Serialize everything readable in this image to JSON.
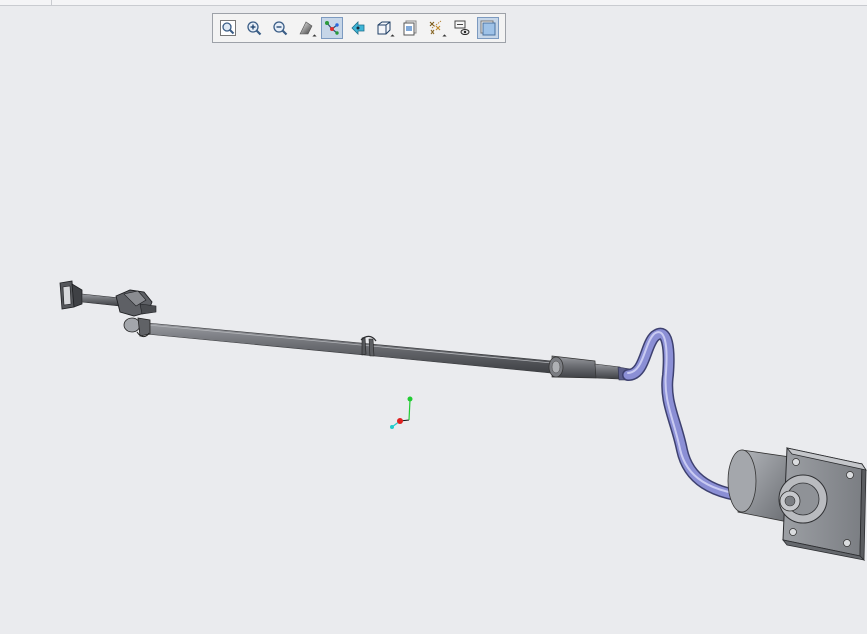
{
  "toolbar": {
    "buttons": [
      {
        "icon": "zoom-fit-icon",
        "active": false
      },
      {
        "icon": "zoom-in-icon",
        "active": false
      },
      {
        "icon": "zoom-out-icon",
        "active": false
      },
      {
        "icon": "shading-style-icon",
        "active": false,
        "dropdown": true
      },
      {
        "icon": "harness-branch-icon",
        "active": true
      },
      {
        "icon": "pan-arrow-icon",
        "active": false
      },
      {
        "icon": "view-cube-icon",
        "active": false,
        "dropdown": true
      },
      {
        "icon": "saved-views-icon",
        "active": false
      },
      {
        "icon": "datum-display-icon",
        "active": false,
        "dropdown": true
      },
      {
        "icon": "spin-center-icon",
        "active": false
      },
      {
        "icon": "display-style-icon",
        "active": true
      }
    ]
  },
  "colors": {
    "background": "#eaebee",
    "tube": "#6b6d71",
    "cable": "#8c90d6",
    "housing": "#8e9196",
    "axis_x": "#e02020",
    "axis_y": "#22cc33",
    "axis_z": "#22cccc"
  }
}
